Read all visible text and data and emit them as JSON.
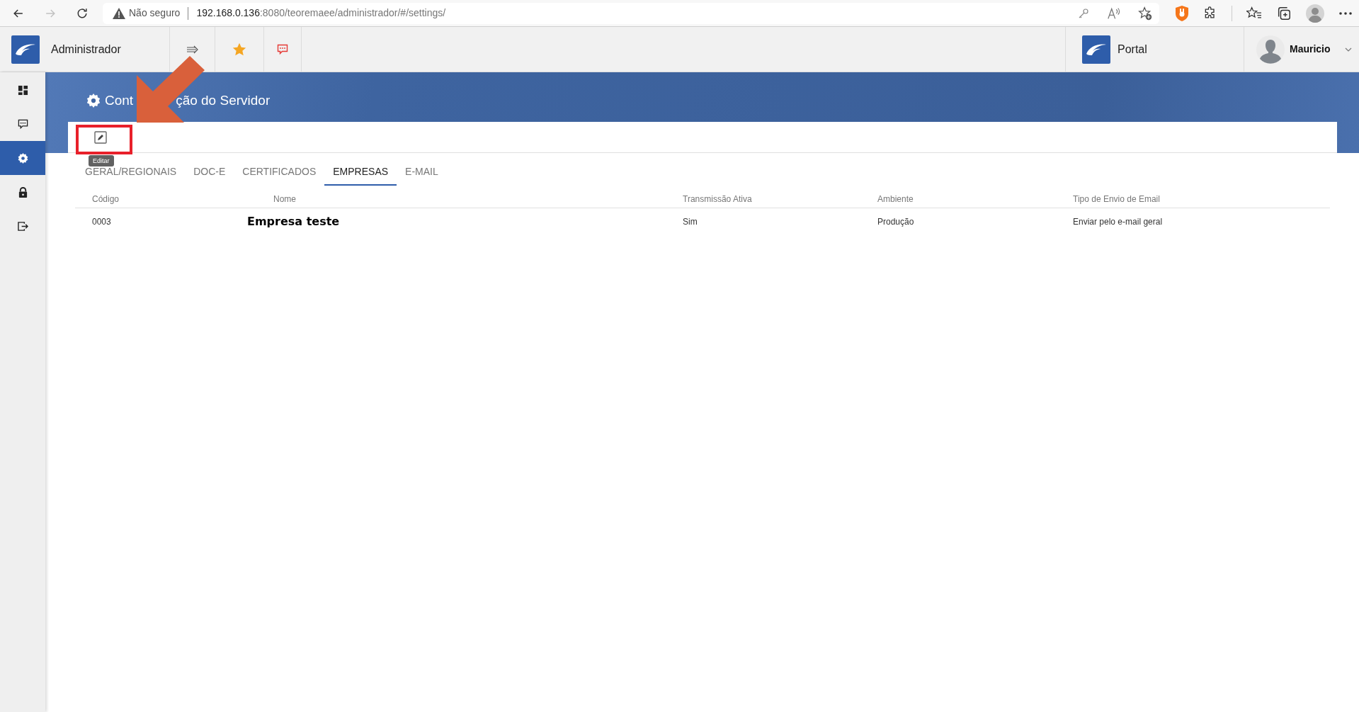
{
  "browser": {
    "nav": [
      {
        "kind": "back",
        "disabled": false
      },
      {
        "kind": "forward",
        "disabled": true
      },
      {
        "kind": "reload",
        "disabled": false
      }
    ],
    "security": "Não seguro",
    "url_host": "192.168.0.136",
    "url_path": ":8080/teoremaee/administrador/#/settings/"
  },
  "app_header": {
    "app_title": "Administrador",
    "portal_label": "Portal",
    "user_name": "Mauricio"
  },
  "sidebar": {
    "items": [
      {
        "kind": "dashboard",
        "selected": false
      },
      {
        "kind": "chat",
        "selected": false
      },
      {
        "kind": "settings",
        "selected": true
      },
      {
        "kind": "lock",
        "selected": false
      },
      {
        "kind": "logout",
        "selected": false
      }
    ]
  },
  "page": {
    "title_parts": [
      "Cont",
      "ção do Servidor"
    ],
    "edit_tooltip": "Editar",
    "tabs": [
      {
        "label": "GERAL/REGIONAIS",
        "selected": false
      },
      {
        "label": "DOC-E",
        "selected": false
      },
      {
        "label": "CERTIFICADOS",
        "selected": false
      },
      {
        "label": "EMPRESAS",
        "selected": true
      },
      {
        "label": "E-MAIL",
        "selected": false
      }
    ],
    "table": {
      "columns": [
        "Código",
        "Nome",
        "Transmissão Ativa",
        "Ambiente",
        "Tipo de Envio de Email"
      ],
      "rows": [
        {
          "cells": [
            "0003",
            "Empresa teste",
            "Sim",
            "Produção",
            "Enviar pelo e-mail geral"
          ]
        }
      ]
    }
  }
}
